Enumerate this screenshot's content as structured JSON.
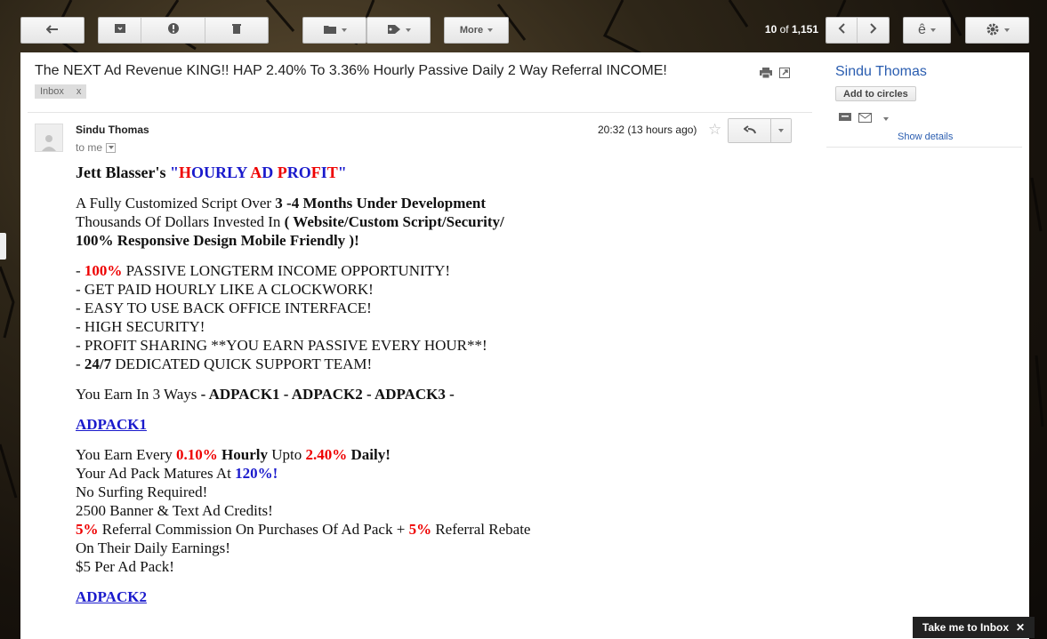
{
  "toolbar": {
    "more_label": "More",
    "counter_range": "10",
    "counter_of": "of",
    "counter_total": "1,151",
    "lang_glyph": "ê"
  },
  "email": {
    "subject": "The NEXT Ad Revenue KING!! HAP 2.40% To 3.36% Hourly Passive Daily 2 Way Referral INCOME!",
    "label": "Inbox",
    "label_remove": "x",
    "sender": "Sindu Thomas",
    "to": "to me",
    "time": "20:32 (13 hours ago)"
  },
  "sidebar": {
    "name": "Sindu Thomas",
    "add_circles": "Add to circles",
    "show_details": "Show details"
  },
  "body": {
    "title_prefix": "Jett Blasser's ",
    "title_q1": "\"",
    "title_h": "H",
    "title_ourly": "OURLY ",
    "title_a": "A",
    "title_d": "D ",
    "title_p": "P",
    "title_ro": "RO",
    "title_f": "F",
    "title_i": "I",
    "title_t": "T",
    "title_q2": "\"",
    "intro1_a": "A Fully Customized Script Over ",
    "intro1_b": "3 -4 Months Under Development",
    "intro2_a": "Thousands Of Dollars Invested In ",
    "intro2_b": "( Website/Custom Script/Security/",
    "intro3": "100% Responsive Design Mobile Friendly )!",
    "b1_dash": "- ",
    "b1_pct": "100%",
    "b1_rest": " PASSIVE LONGTERM INCOME OPPORTUNITY!",
    "b2": "- GET PAID HOURLY LIKE A CLOCKWORK!",
    "b3": "- EASY TO USE BACK OFFICE INTERFACE!",
    "b4": "- HIGH SECURITY!",
    "b5": "- PROFIT SHARING **YOU EARN PASSIVE EVERY HOUR**!",
    "b6_dash": "- ",
    "b6_bold": "24/7",
    "b6_rest": " DEDICATED QUICK SUPPORT TEAM!",
    "ways_a": "You Earn In 3 Ways ",
    "ways_b": "- ADPACK1 - ADPACK2 - ADPACK3 -",
    "adpack1": "ADPACK1",
    "e1_a": "You Earn Every ",
    "e1_b": "0.10%",
    "e1_c": " ",
    "e1_d": "Hourly",
    "e1_e": " Upto ",
    "e1_f": "2.40%",
    "e1_g": " Daily!",
    "e2_a": "Your Ad Pack Matures At ",
    "e2_b": "120%!",
    "e3": "No Surfing Required!",
    "e4": "2500 Banner & Text Ad Credits!",
    "e5_a": "5%",
    "e5_b": " Referral Commission On Purchases Of Ad Pack + ",
    "e5_c": "5%",
    "e5_d": " Referral Rebate",
    "e6": "On Their Daily Earnings!",
    "e7": "$5 Per Ad Pack!",
    "adpack2": "ADPACK2"
  },
  "footer": {
    "take_me": "Take me to Inbox",
    "close": "✕"
  }
}
